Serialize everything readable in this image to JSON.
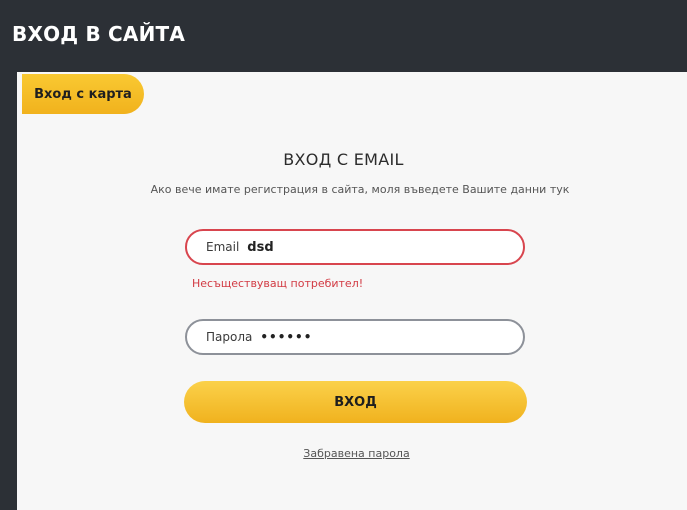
{
  "header": {
    "title": "ВХОД В САЙТА"
  },
  "card_login": {
    "label": "Вход с карта"
  },
  "email_login": {
    "heading": "ВХОД С EMAIL",
    "subtitle": "Ако вече имате регистрация в сайта, моля въведете Вашите данни тук",
    "email_label": "Email",
    "email_value": "dsd",
    "error_message": "Несъществуващ потребител!",
    "password_label": "Парола",
    "password_value": "••••••",
    "submit_label": "ВХОД",
    "forgot_password_label": "Забравена парола"
  },
  "colors": {
    "header_bg": "#2c3036",
    "accent": "#f6c12b",
    "error": "#d8454e"
  }
}
